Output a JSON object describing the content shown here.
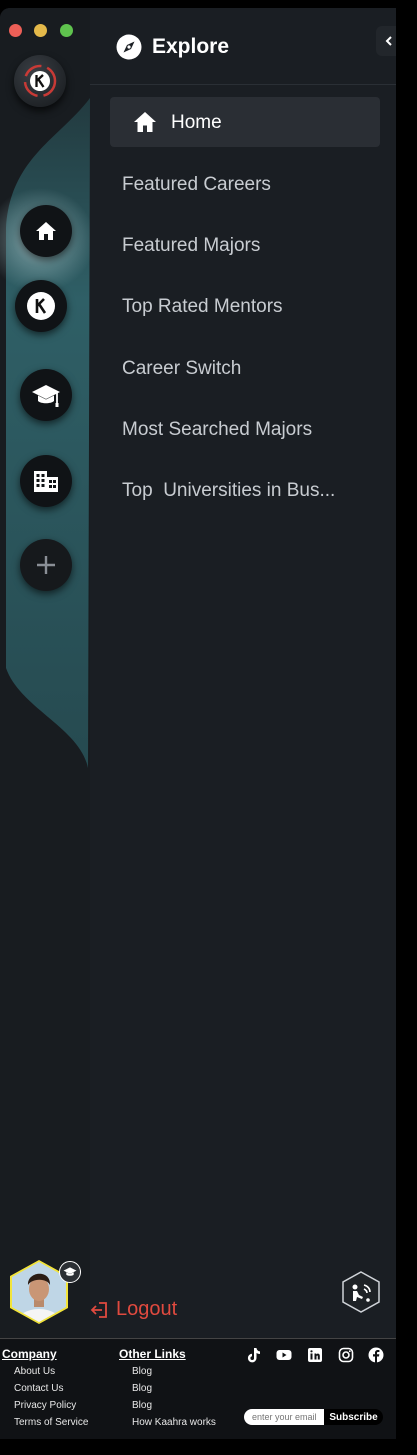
{
  "window": {
    "traffic_lights": {
      "close": "#ec5f57",
      "minimize": "#e4b94a",
      "maximize": "#5fc34e"
    }
  },
  "rail": {
    "logo_letter": "K",
    "items": [
      {
        "name": "home",
        "icon": "home-icon",
        "active": true
      },
      {
        "name": "kaahra",
        "icon": "k-logo-icon",
        "letter": "K"
      },
      {
        "name": "majors",
        "icon": "graduation-cap-icon"
      },
      {
        "name": "universities",
        "icon": "building-icon"
      },
      {
        "name": "add",
        "icon": "plus-icon"
      }
    ]
  },
  "panel": {
    "title": "Explore",
    "title_icon": "compass-icon",
    "collapse_icon": "chevron-left-icon",
    "active_item": {
      "label": "Home",
      "icon": "home-icon"
    },
    "items": [
      {
        "label": "Featured Careers"
      },
      {
        "label": "Featured Majors"
      },
      {
        "label": "Top Rated Mentors"
      },
      {
        "label": "Career Switch"
      },
      {
        "label": "Most Searched Majors"
      },
      {
        "label": "Top  Universities in Bus..."
      }
    ]
  },
  "user": {
    "logout_label": "Logout",
    "badge_icon": "graduation-cap-icon",
    "avatar_border": "#f2e43a"
  },
  "footer": {
    "company": {
      "heading": "Company",
      "links": [
        "About Us",
        "Contact Us",
        "Privacy Policy",
        "Terms of Service"
      ]
    },
    "other": {
      "heading": "Other Links",
      "links": [
        "Blog",
        "Blog",
        "Blog",
        "How Kaahra works"
      ]
    },
    "social": [
      "tiktok-icon",
      "youtube-icon",
      "linkedin-icon",
      "instagram-icon",
      "facebook-icon"
    ],
    "email_placeholder": "enter your email",
    "subscribe_label": "Subscribe"
  },
  "colors": {
    "accent_teal": "#2f5c62",
    "logout": "#e04a3f",
    "active_bg": "#2a2e34"
  }
}
